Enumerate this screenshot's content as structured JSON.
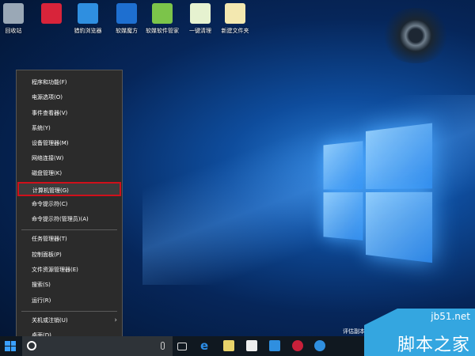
{
  "desktop_icons": [
    {
      "label": "回收站",
      "color": "#9aa8b6"
    },
    {
      "label": "",
      "color": "#d8243a"
    },
    {
      "label": "猎豹浏览器",
      "color": "#2f8fe0"
    },
    {
      "label": "软媒魔方",
      "color": "#1e6fd0"
    },
    {
      "label": "软媒软件管家",
      "color": "#7cc44a"
    },
    {
      "label": "一键清理",
      "color": "#e6f2d0"
    },
    {
      "label": "新建文件夹",
      "color": "#f3e8b0"
    }
  ],
  "menu": {
    "group1": [
      "程序和功能(F)",
      "电源选项(O)",
      "事件查看器(V)",
      "系统(Y)",
      "设备管理器(M)",
      "网络连接(W)",
      "磁盘管理(K)",
      "计算机管理(G)",
      "命令提示符(C)",
      "命令提示符(管理员)(A)"
    ],
    "group2": [
      "任务管理器(T)",
      "控制面板(P)",
      "文件资源管理器(E)",
      "搜索(S)",
      "运行(R)"
    ],
    "group3": [
      "关机或注销(U)",
      "桌面(D)"
    ],
    "highlighted": "计算机管理(G)"
  },
  "taskbar": {
    "eval_text": "评估副本"
  },
  "watermark": {
    "site": "jb51.net",
    "name": "脚本之家"
  }
}
